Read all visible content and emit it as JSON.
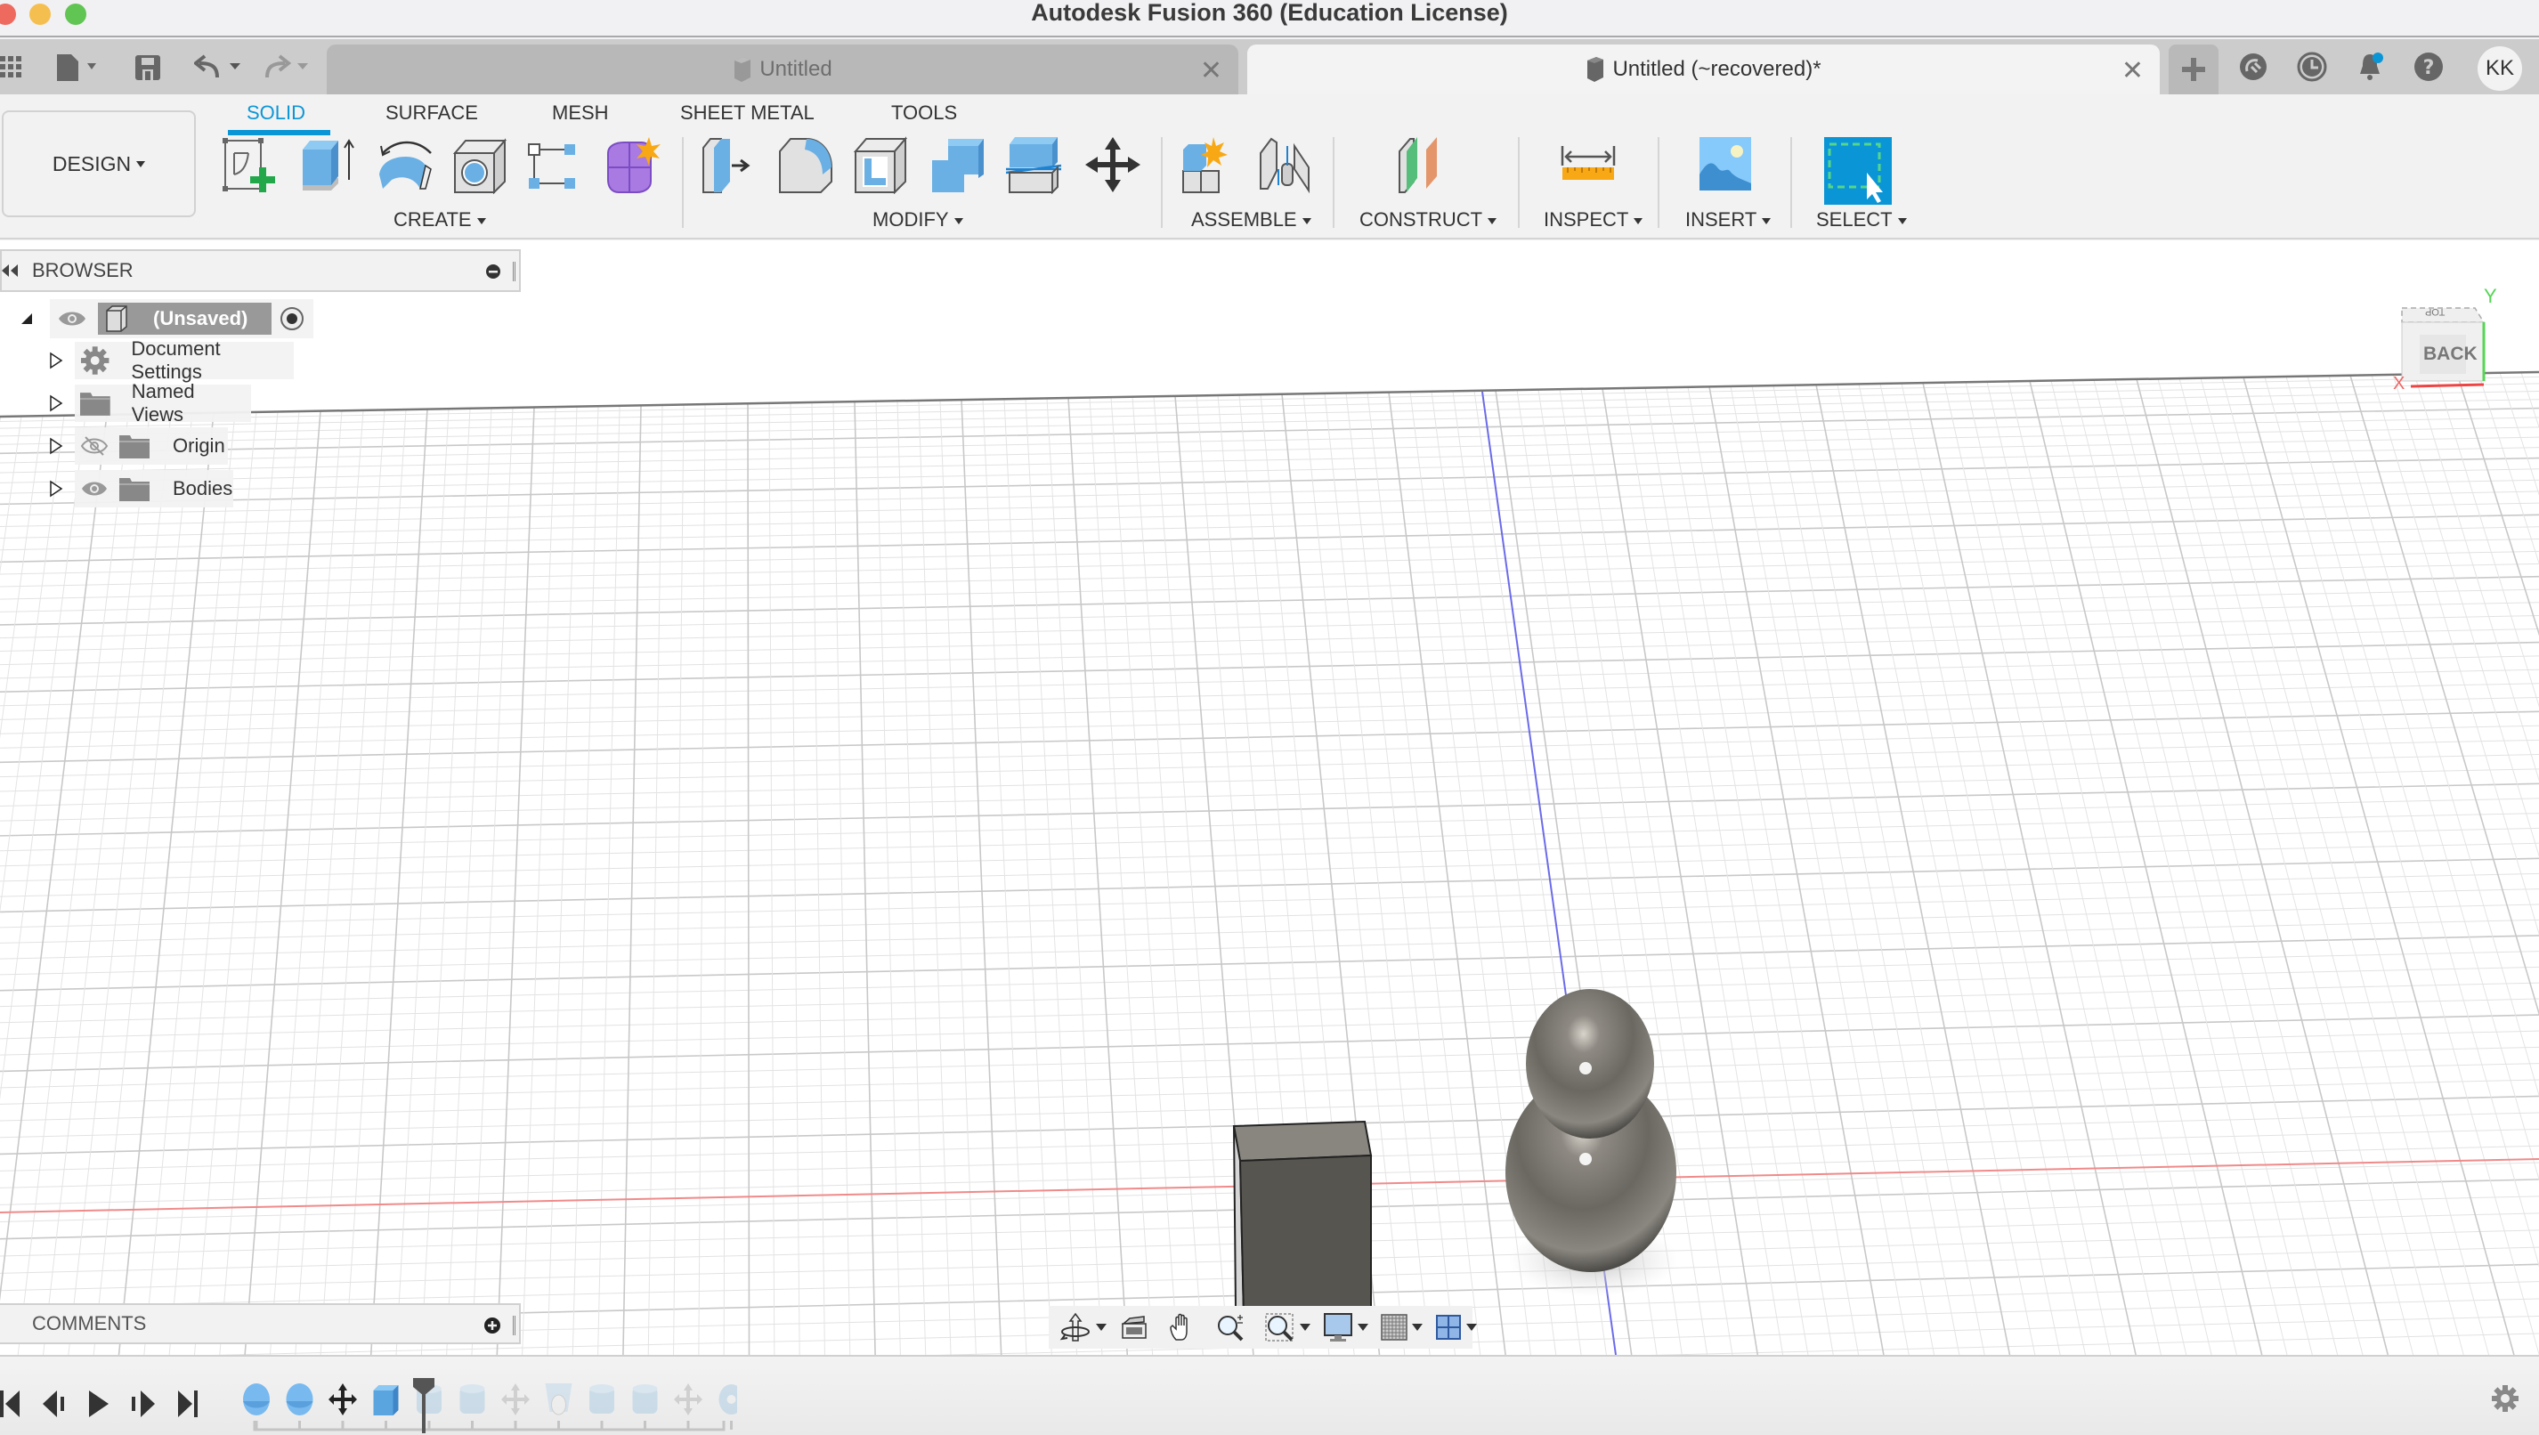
{
  "window": {
    "title": "Autodesk Fusion 360 (Education License)"
  },
  "quick_access": {
    "data_panel_icon": "grid-icon",
    "file_icon": "file-icon",
    "save_icon": "save-icon",
    "undo_icon": "undo-icon",
    "redo_icon": "redo-icon"
  },
  "document_tabs": [
    {
      "label": "Untitled",
      "active": false
    },
    {
      "label": "Untitled (~recovered)*",
      "active": true
    }
  ],
  "tab_close_glyph": "✕",
  "right_icons": [
    "new-tab-icon",
    "extensions-icon",
    "job-status-icon",
    "notifications-icon",
    "help-icon"
  ],
  "user": {
    "initials": "KK"
  },
  "accent_color": "#0a96d6",
  "ribbon": {
    "workspace_button": "DESIGN",
    "workspace_tabs": [
      {
        "label": "SOLID",
        "active": true
      },
      {
        "label": "SURFACE",
        "active": false
      },
      {
        "label": "MESH",
        "active": false
      },
      {
        "label": "SHEET METAL",
        "active": false
      },
      {
        "label": "TOOLS",
        "active": false
      }
    ],
    "groups": [
      {
        "label": "CREATE",
        "tools": [
          "create-sketch",
          "extrude",
          "revolve",
          "hole",
          "pattern",
          "create-form"
        ]
      },
      {
        "label": "MODIFY",
        "tools": [
          "press-pull",
          "fillet",
          "shell",
          "combine",
          "split-body",
          "move-copy"
        ]
      },
      {
        "label": "ASSEMBLE",
        "tools": [
          "new-component",
          "joint"
        ]
      },
      {
        "label": "CONSTRUCT",
        "tools": [
          "offset-plane"
        ]
      },
      {
        "label": "INSPECT",
        "tools": [
          "measure"
        ]
      },
      {
        "label": "INSERT",
        "tools": [
          "insert-image"
        ]
      },
      {
        "label": "SELECT",
        "tools": [
          "window-select"
        ]
      }
    ]
  },
  "browser": {
    "title": "BROWSER",
    "root": {
      "label": "(Unsaved)",
      "expanded": true,
      "visible": true
    },
    "items": [
      {
        "label": "Document Settings",
        "icon": "gear-icon",
        "visibility": null
      },
      {
        "label": "Named Views",
        "icon": "folder-icon",
        "visibility": null
      },
      {
        "label": "Origin",
        "icon": "folder-icon",
        "visibility": "hidden"
      },
      {
        "label": "Bodies",
        "icon": "folder-icon",
        "visibility": "visible"
      }
    ]
  },
  "comments": {
    "title": "COMMENTS"
  },
  "viewcube": {
    "face": "BACK",
    "top_face": "TOP",
    "axis_x": "X",
    "axis_y": "Y"
  },
  "nav_toolbar": [
    "orbit",
    "look-at",
    "pan",
    "zoom",
    "zoom-window",
    "display-settings",
    "grid-snaps",
    "viewports"
  ],
  "timeline": {
    "controls": [
      "go-to-start",
      "step-back",
      "play",
      "step-forward",
      "go-to-end"
    ],
    "features": [
      {
        "type": "sphere",
        "active": true
      },
      {
        "type": "sphere",
        "active": true
      },
      {
        "type": "move",
        "active": true
      },
      {
        "type": "box",
        "active": true
      },
      {
        "type": "cylinder",
        "active": false
      },
      {
        "type": "cylinder",
        "active": false
      },
      {
        "type": "move",
        "active": false
      },
      {
        "type": "loft",
        "active": false
      },
      {
        "type": "cylinder",
        "active": false
      },
      {
        "type": "cylinder",
        "active": false
      },
      {
        "type": "move",
        "active": false
      },
      {
        "type": "torus",
        "active": false
      }
    ],
    "marker_after_index": 3
  }
}
